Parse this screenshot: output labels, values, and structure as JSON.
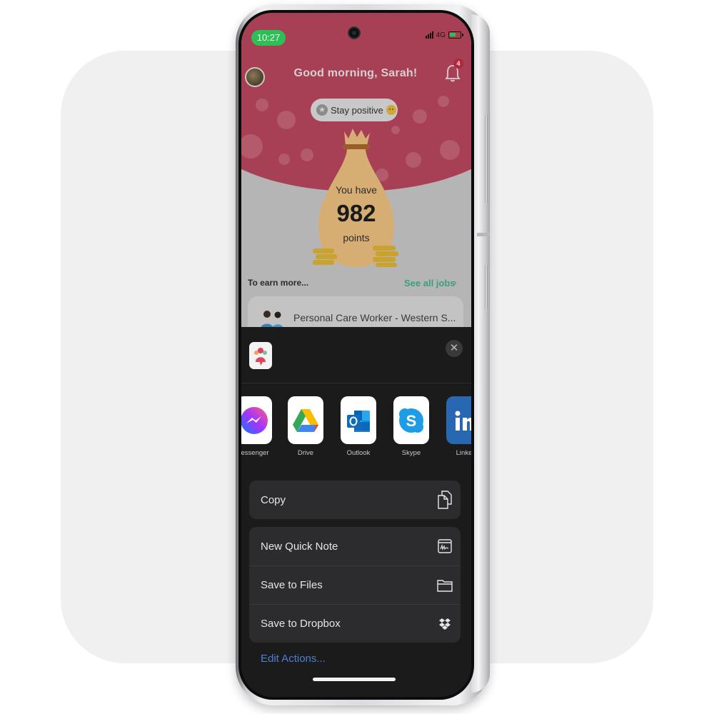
{
  "status_bar": {
    "time": "10:27",
    "network": "4G",
    "icons": [
      "signal-icon",
      "battery-charging-icon"
    ]
  },
  "app": {
    "greeting": "Good morning, Sarah!",
    "notification_count": "4",
    "mood_pill": {
      "label": "Stay positive",
      "icons": [
        "star-icon",
        "smiley-emoji-icon"
      ]
    },
    "points": {
      "prefix": "You have",
      "value": "982",
      "suffix": "points"
    },
    "earn_more_label": "To earn more...",
    "see_all_label": "See all jobs",
    "job_card": {
      "title": "Personal Care Worker - Western S..."
    },
    "colors": {
      "hero": "#a73f55",
      "accent_green": "#3c9e80"
    }
  },
  "share_sheet": {
    "close_icon": "close-icon",
    "apps": [
      {
        "label": "Messenger",
        "display_label": "lessenger",
        "icon": "messenger-icon"
      },
      {
        "label": "Drive",
        "display_label": "Drive",
        "icon": "google-drive-icon"
      },
      {
        "label": "Outlook",
        "display_label": "Outlook",
        "icon": "outlook-icon"
      },
      {
        "label": "Skype",
        "display_label": "Skype",
        "icon": "skype-icon"
      },
      {
        "label": "LinkedIn",
        "display_label": "Linke",
        "icon": "linkedin-icon"
      }
    ],
    "action_groups": [
      [
        {
          "label": "Copy",
          "icon": "copy-icon"
        }
      ],
      [
        {
          "label": "New Quick Note",
          "icon": "quick-note-icon"
        },
        {
          "label": "Save to Files",
          "icon": "folder-icon"
        },
        {
          "label": "Save to Dropbox",
          "icon": "dropbox-icon"
        }
      ]
    ],
    "edit_actions_label": "Edit Actions...",
    "colors": {
      "sheet_bg": "#1b1b1c",
      "row_bg": "#2c2c2e",
      "link_blue": "#4d7fd3"
    }
  }
}
